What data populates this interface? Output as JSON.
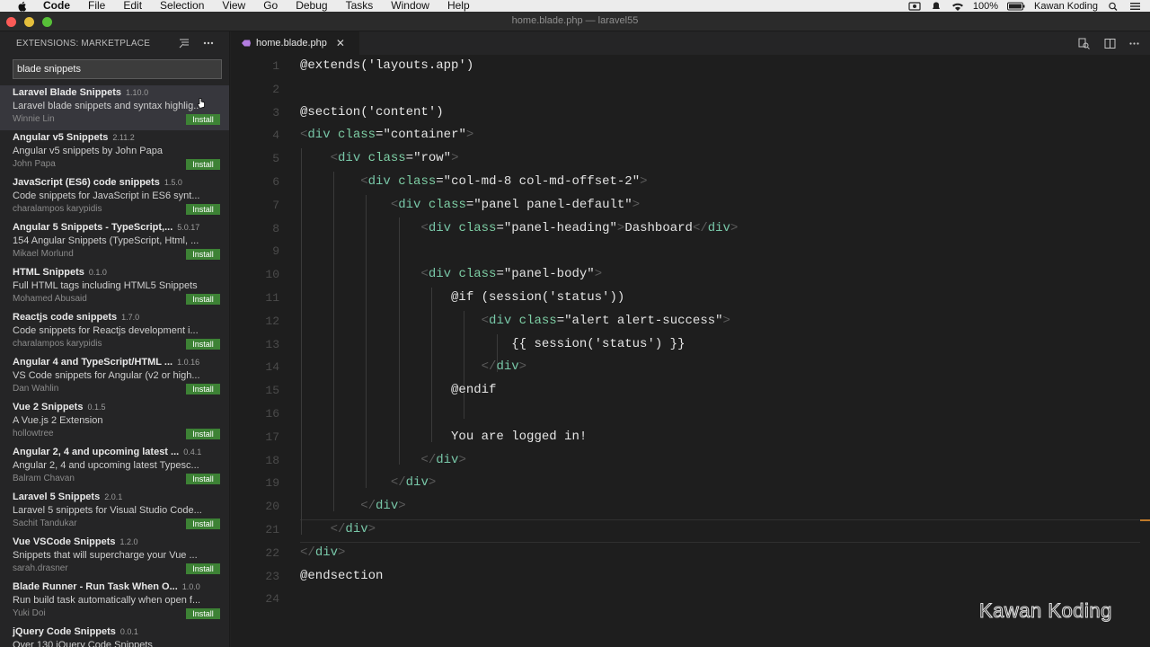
{
  "menubar": {
    "app": "Code",
    "items": [
      "File",
      "Edit",
      "Selection",
      "View",
      "Go",
      "Debug",
      "Tasks",
      "Window",
      "Help"
    ],
    "battery": "100%",
    "user": "Kawan Koding"
  },
  "window": {
    "title": "home.blade.php — laravel55"
  },
  "sidebar": {
    "header": "EXTENSIONS: MARKETPLACE",
    "search_value": "blade snippets",
    "extensions": [
      {
        "name": "Laravel Blade Snippets",
        "version": "1.10.0",
        "desc": "Laravel blade snippets and syntax highlig...",
        "author": "Winnie Lin",
        "install": "Install"
      },
      {
        "name": "Angular v5 Snippets",
        "version": "2.11.2",
        "desc": "Angular v5 snippets by John Papa",
        "author": "John Papa",
        "install": "Install"
      },
      {
        "name": "JavaScript (ES6) code snippets",
        "version": "1.5.0",
        "desc": "Code snippets for JavaScript in ES6 synt...",
        "author": "charalampos karypidis",
        "install": "Install"
      },
      {
        "name": "Angular 5 Snippets - TypeScript,...",
        "version": "5.0.17",
        "desc": "154 Angular Snippets (TypeScript, Html, ...",
        "author": "Mikael Morlund",
        "install": "Install"
      },
      {
        "name": "HTML Snippets",
        "version": "0.1.0",
        "desc": "Full HTML tags including HTML5 Snippets",
        "author": "Mohamed Abusaid",
        "install": "Install"
      },
      {
        "name": "Reactjs code snippets",
        "version": "1.7.0",
        "desc": "Code snippets for Reactjs development i...",
        "author": "charalampos karypidis",
        "install": "Install"
      },
      {
        "name": "Angular 4 and TypeScript/HTML ...",
        "version": "1.0.16",
        "desc": "VS Code snippets for Angular (v2 or high...",
        "author": "Dan Wahlin",
        "install": "Install"
      },
      {
        "name": "Vue 2 Snippets",
        "version": "0.1.5",
        "desc": "A Vue.js 2 Extension",
        "author": "hollowtree",
        "install": "Install"
      },
      {
        "name": "Angular 2, 4 and upcoming latest ...",
        "version": "0.4.1",
        "desc": "Angular 2, 4 and upcoming latest Typesc...",
        "author": "Balram Chavan",
        "install": "Install"
      },
      {
        "name": "Laravel 5 Snippets",
        "version": "2.0.1",
        "desc": "Laravel 5 snippets for Visual Studio Code...",
        "author": "Sachit Tandukar",
        "install": "Install"
      },
      {
        "name": "Vue VSCode Snippets",
        "version": "1.2.0",
        "desc": "Snippets that will supercharge your Vue ...",
        "author": "sarah.drasner",
        "install": "Install"
      },
      {
        "name": "Blade Runner - Run Task When O...",
        "version": "1.0.0",
        "desc": "Run build task automatically when open f...",
        "author": "Yuki Doi",
        "install": "Install"
      },
      {
        "name": "jQuery Code Snippets",
        "version": "0.0.1",
        "desc": "Over 130 jQuery Code Snippets",
        "author": "",
        "install": ""
      }
    ]
  },
  "editor": {
    "tab": "home.blade.php",
    "lines": [
      {
        "n": "1",
        "t": "@extends('layouts.app')"
      },
      {
        "n": "2",
        "t": ""
      },
      {
        "n": "3",
        "t": "@section('content')"
      },
      {
        "n": "4",
        "t": "<div class=\"container\">"
      },
      {
        "n": "5",
        "t": "    <div class=\"row\">"
      },
      {
        "n": "6",
        "t": "        <div class=\"col-md-8 col-md-offset-2\">"
      },
      {
        "n": "7",
        "t": "            <div class=\"panel panel-default\">"
      },
      {
        "n": "8",
        "t": "                <div class=\"panel-heading\">Dashboard</div>"
      },
      {
        "n": "9",
        "t": ""
      },
      {
        "n": "10",
        "t": "                <div class=\"panel-body\">"
      },
      {
        "n": "11",
        "t": "                    @if (session('status'))"
      },
      {
        "n": "12",
        "t": "                        <div class=\"alert alert-success\">"
      },
      {
        "n": "13",
        "t": "                            {{ session('status') }}"
      },
      {
        "n": "14",
        "t": "                        </div>"
      },
      {
        "n": "15",
        "t": "                    @endif"
      },
      {
        "n": "16",
        "t": ""
      },
      {
        "n": "17",
        "t": "                    You are logged in!"
      },
      {
        "n": "18",
        "t": "                </div>"
      },
      {
        "n": "19",
        "t": "            </div>"
      },
      {
        "n": "20",
        "t": "        </div>"
      },
      {
        "n": "21",
        "t": "    </div>"
      },
      {
        "n": "22",
        "t": "</div>"
      },
      {
        "n": "23",
        "t": "@endsection"
      },
      {
        "n": "24",
        "t": ""
      }
    ]
  },
  "watermark": "Kawan Koding",
  "colors": {
    "install": "#3d8235",
    "tag": "#78c7a8",
    "editor_bg": "#1e1e1e",
    "sidebar_bg": "#252526"
  }
}
